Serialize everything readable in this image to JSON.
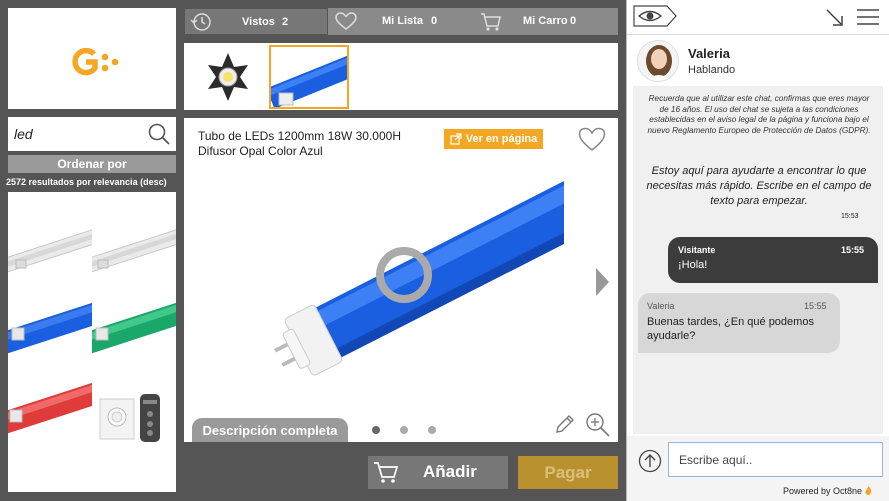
{
  "logo": {
    "icon": "g-logo",
    "color": "#f5a623"
  },
  "search": {
    "value": "led",
    "icon": "search-icon"
  },
  "sort": {
    "label": "Ordenar por"
  },
  "results": {
    "count_text": "2572 resultados por relevancia (desc)"
  },
  "nav": {
    "vistos_label": "Vistos",
    "vistos_count": "2",
    "milista_label": "Mi Lista",
    "milista_count": "0",
    "micarro_label": "Mi Carro",
    "micarro_count": "0"
  },
  "product": {
    "title": "Tubo de LEDs 1200mm 18W 30.000H Difusor Opal Color Azul",
    "view_label": "Ver en página",
    "description_label": "Descripción completa",
    "image_dots": 3,
    "active_dot": 0
  },
  "actions": {
    "add_label": "Añadir",
    "pay_label": "Pagar"
  },
  "colors": {
    "accent": "#f5a623",
    "pay": "#b8912e",
    "tube_blue": "#1a5fe0"
  },
  "chat": {
    "agent_name": "Valeria",
    "agent_status": "Hablando",
    "legal_text": "Recuerda que al utilizar este chat, confirmas que eres mayor de 16 años. El uso del chat se sujeta a las condiciones establecidas en el aviso legal de la página y funciona bajo el nuevo Reglamento Europeo de Protección de Datos (GDPR).",
    "welcome_text": "Estoy aquí para ayudarte a encontrar lo que necesitas más rápido. Escribe en el campo de texto para empezar.",
    "welcome_time": "15:53",
    "visitor_name": "Visitante",
    "visitor_time": "15:55",
    "visitor_text": "¡Hola!",
    "agent_msg_name": "Valeria",
    "agent_msg_time": "15:55",
    "agent_msg_text": "Buenas tardes, ¿En qué podemos ayudarle?",
    "input_placeholder": "Escribe aquí..",
    "powered_by": "Powered by Oct8ne"
  }
}
